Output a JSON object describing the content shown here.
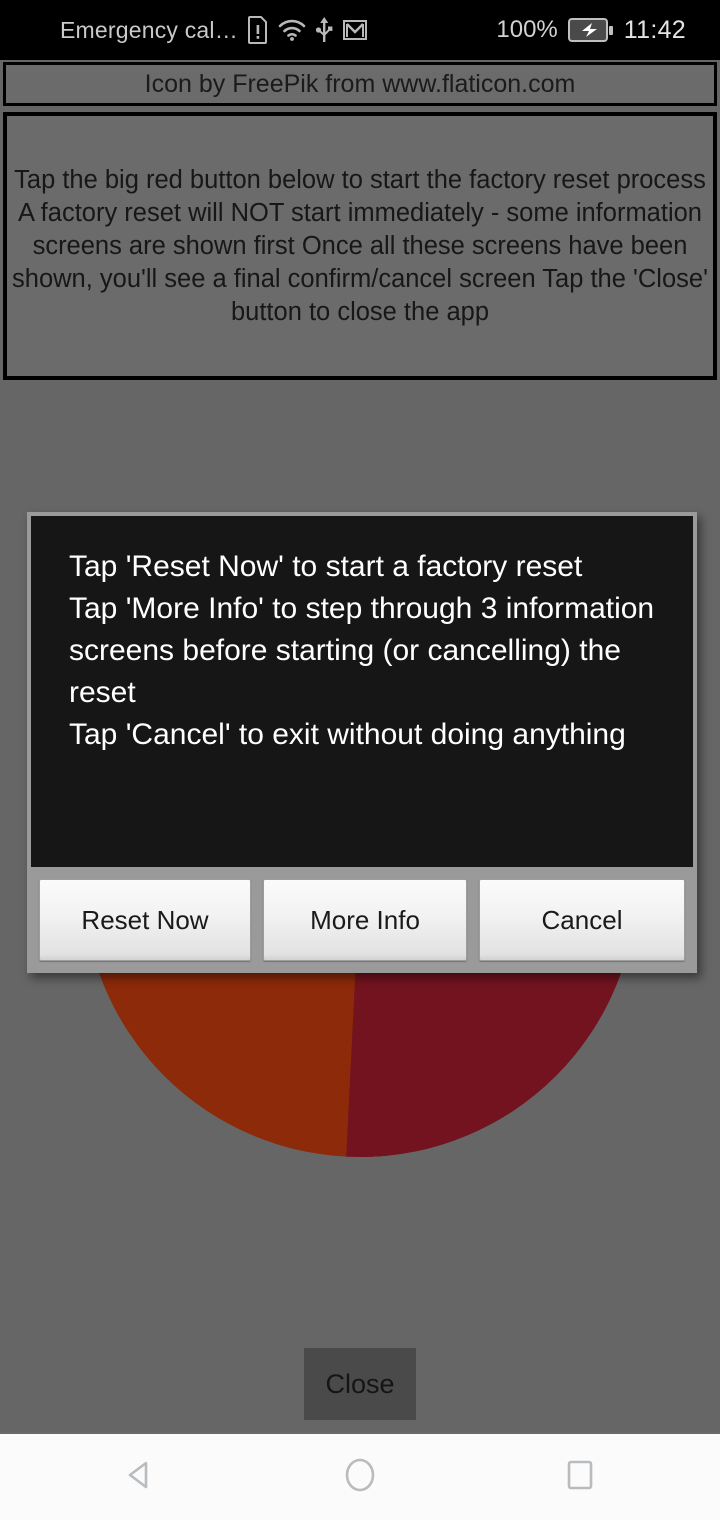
{
  "status_bar": {
    "carrier": "Emergency cal…",
    "icons": [
      "sim-alert-icon",
      "wifi-icon",
      "usb-icon",
      "gmail-icon"
    ],
    "battery_percent": "100%",
    "battery_state": "charging",
    "time": "11:42",
    "background": "#000000",
    "text_color": "#c9c9c9"
  },
  "credit_banner": {
    "text": "Icon by FreePik from www.flaticon.com"
  },
  "info_box": {
    "text": "Tap the big red button below to start the factory reset process\nA factory reset will NOT start immediately - some information screens are shown first\nOnce all these screens have been shown, you'll see a final confirm/cancel screen\nTap the 'Close' button to close the app"
  },
  "artwork": {
    "name": "factory-reset-power-icon",
    "outer_color": "#8c2a0a",
    "shadow_color": "#72131f",
    "inner_color": "#1b1b1b",
    "highlight_color": "#2a2a2a"
  },
  "dialog": {
    "message": "Tap 'Reset Now' to start a factory reset\nTap 'More Info' to step through 3 information screens before starting (or cancelling) the reset\nTap 'Cancel' to exit without doing anything",
    "buttons": [
      {
        "label": "Reset Now",
        "name": "reset-now-button"
      },
      {
        "label": "More Info",
        "name": "more-info-button"
      },
      {
        "label": "Cancel",
        "name": "cancel-button"
      }
    ],
    "frame_color": "#9a9a9a",
    "body_color": "#0c0c0c",
    "text_color": "#ffffff"
  },
  "close_button": {
    "label": "Close"
  },
  "nav_bar": {
    "buttons": [
      {
        "name": "nav-back-button",
        "icon": "back-triangle-icon"
      },
      {
        "name": "nav-home-button",
        "icon": "home-circle-icon"
      },
      {
        "name": "nav-recents-button",
        "icon": "recents-square-icon"
      }
    ],
    "background": "#fbfbfb",
    "icon_color": "#b8bcbf"
  },
  "screen": {
    "background": "#666666"
  }
}
